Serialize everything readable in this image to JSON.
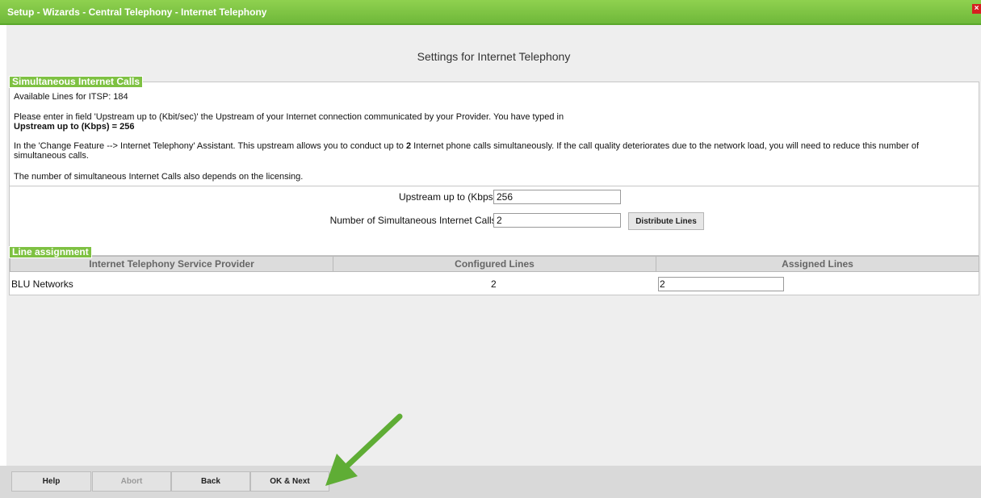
{
  "window": {
    "title": "Setup - Wizards - Central Telephony - Internet Telephony",
    "close_glyph": "×"
  },
  "page": {
    "heading": "Settings for Internet Telephony"
  },
  "simultaneous": {
    "label": "Simultaneous Internet Calls",
    "available_lines": "Available Lines for ITSP: 184",
    "instruction": "Please enter in field 'Upstream up to (Kbit/sec)' the Upstream of your Internet connection communicated by your Provider. You have typed in",
    "upstream_summary": "Upstream up to (Kbps) = 256",
    "assistant_text_part1": "In the 'Change Feature --> Internet Telephony' Assistant. This upstream allows you to conduct up to ",
    "assistant_count": "2",
    "assistant_text_part2": " Internet phone calls simultaneously. If the call quality deteriorates due to the network load, you will need to reduce this number of simultaneous calls.",
    "licensing_note": "The number of simultaneous Internet Calls also depends on the licensing.",
    "upstream_label": "Upstream up to (Kbps):",
    "upstream_value": "256",
    "calls_label": "Number of Simultaneous Internet Calls:",
    "calls_value": "2",
    "distribute_button": "Distribute Lines"
  },
  "line_assignment": {
    "label": "Line assignment",
    "columns": [
      "Internet Telephony Service Provider",
      "Configured Lines",
      "Assigned Lines"
    ],
    "rows": [
      {
        "provider": "BLU Networks",
        "configured": "2",
        "assigned": "2"
      }
    ]
  },
  "footer": {
    "help": "Help",
    "abort": "Abort",
    "back": "Back",
    "ok_next": "OK & Next"
  },
  "colors": {
    "accent": "#7ec142",
    "arrow": "#5fad35",
    "close": "#d62020"
  }
}
